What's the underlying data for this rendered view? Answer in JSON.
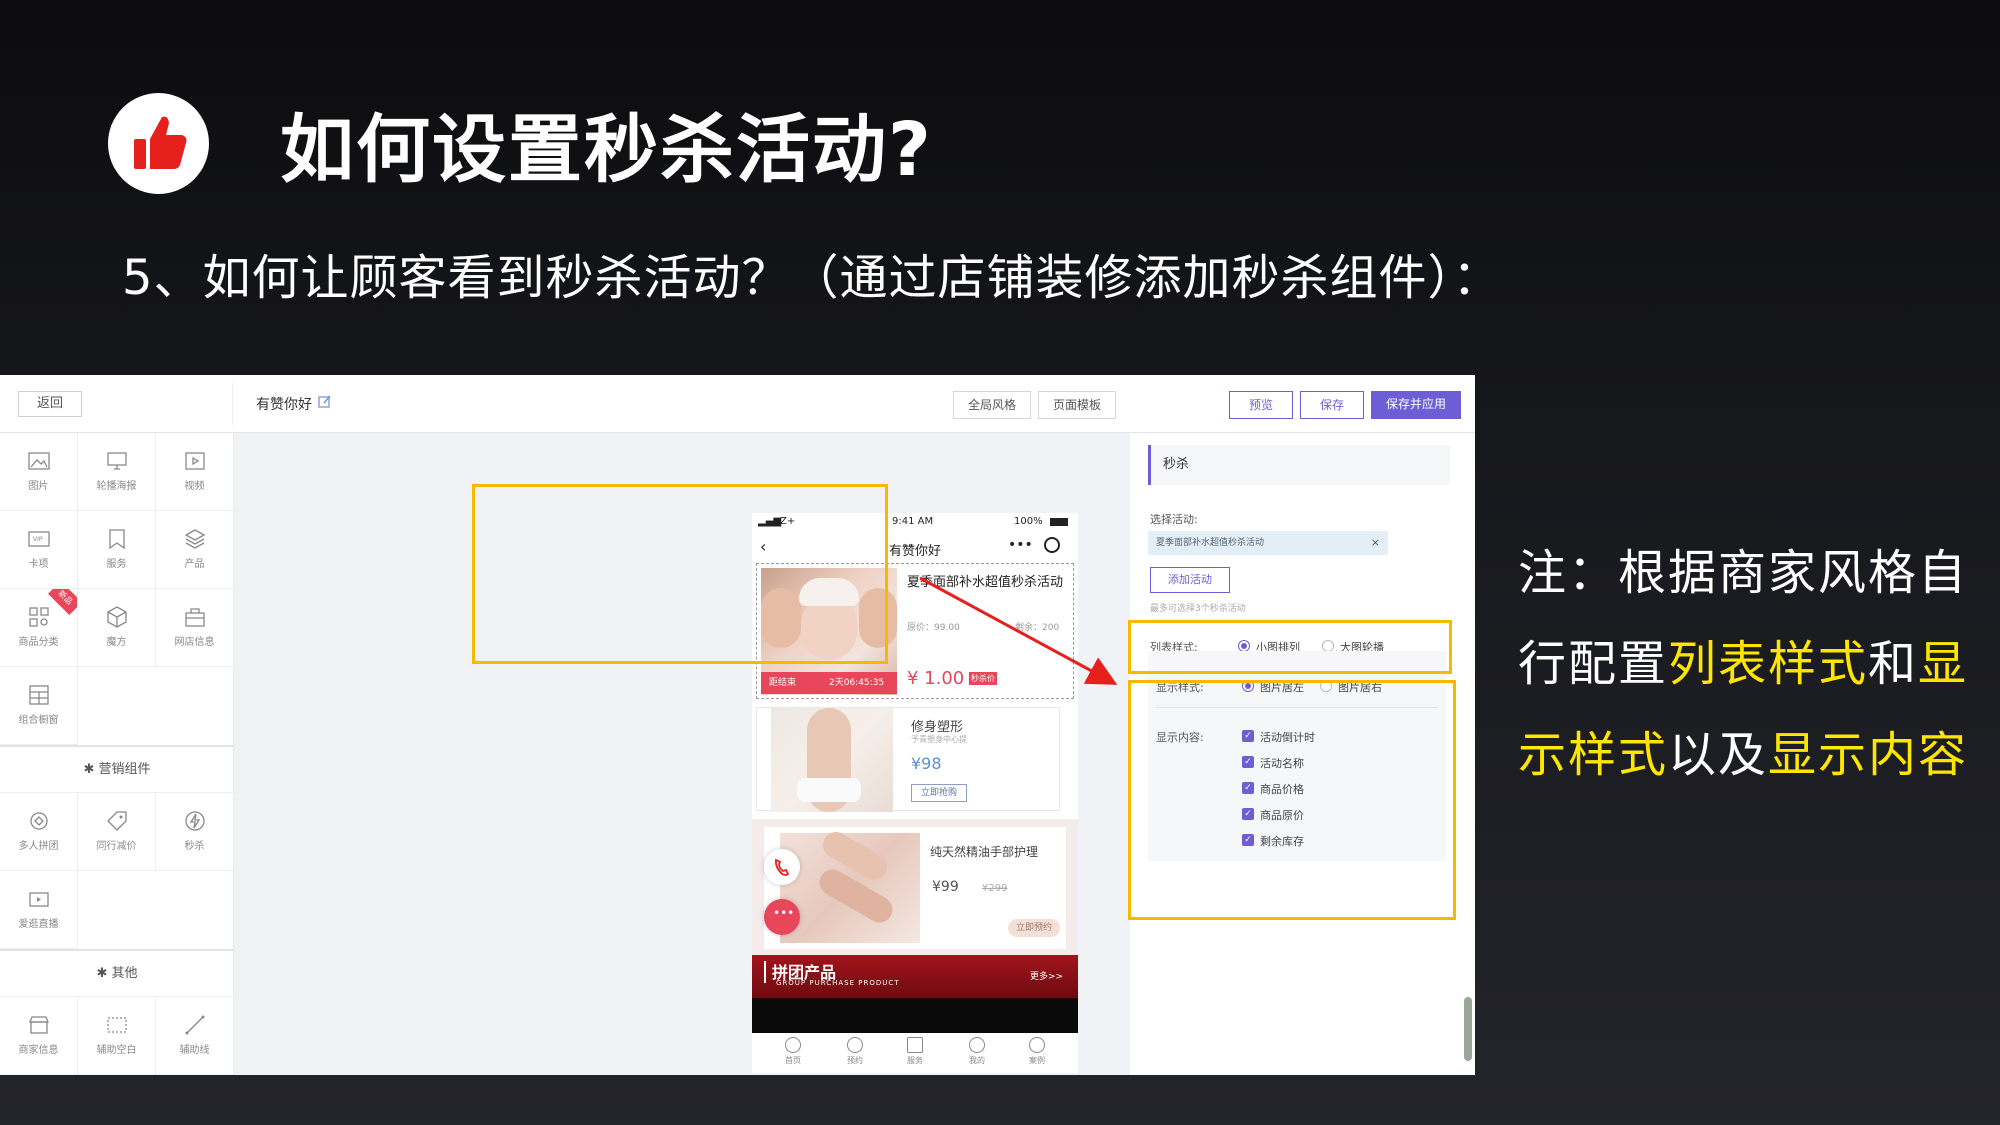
{
  "slide": {
    "title": "如何设置秒杀活动?",
    "subtitle": "5、如何让顾客看到秒杀活动？（通过店铺装修添加秒杀组件）：",
    "note": {
      "p1": "注：根据商家风格自行配置",
      "hl1": "列表样式",
      "p2": "和",
      "hl2": "显示样式",
      "p3": "以及",
      "hl3": "显示内容"
    },
    "highlight_color": "#ffe600",
    "box_color": "#f5b900",
    "arrow_color": "#e5201d"
  },
  "editor": {
    "back_label": "返回",
    "store_name": "有赞你好",
    "global_style": "全局风格",
    "page_template": "页面模板",
    "preview": "预览",
    "save": "保存",
    "save_apply": "保存并应用",
    "accent": "#6e5ed6"
  },
  "left_panel": {
    "basic": [
      "图片",
      "轮播海报",
      "视频",
      "卡项",
      "服务",
      "产品",
      "商品分类",
      "魔方",
      "网店信息",
      "组合橱窗"
    ],
    "ribbon": "新品",
    "marketing_title": "营销组件",
    "marketing": [
      "多人拼团",
      "同行减价",
      "秒杀",
      "爱逛直播"
    ],
    "other_title": "其他",
    "other": [
      "商家信息",
      "辅助空白",
      "辅助线"
    ]
  },
  "phone": {
    "carrier": "Z+",
    "time": "9:41 AM",
    "battery": "100%",
    "nav_title": "有赞你好",
    "item1": {
      "title": "夏季面部补水超值秒杀活动",
      "orig_price": "原价：99.00",
      "remaining": "剩余：200",
      "countdown_label": "距结束",
      "countdown": "2天06:45:35",
      "price": "¥ 1.00",
      "tag": "秒杀价"
    },
    "item2": {
      "title": "修身塑形",
      "sub": "予青塑身中心提",
      "price": "¥98",
      "button": "立即抢购"
    },
    "item3": {
      "title": "纯天然精油手部护理",
      "price": "¥99",
      "old_price": "¥299",
      "button": "立即预约"
    },
    "banner": {
      "title": "拼团产品",
      "en": "GROUP PURCHASE PRODUCT",
      "more": "更多>>"
    },
    "tabs": [
      "首页",
      "预约",
      "服务",
      "我的",
      "案例"
    ]
  },
  "right_panel": {
    "header": "秒杀",
    "select_label": "选择活动:",
    "selected_activity": "夏季面部补水超值秒杀活动",
    "add_button": "添加活动",
    "hint": "最多可选择3个秒杀活动",
    "list_style_label": "列表样式:",
    "list_opt1": "小图排列",
    "list_opt2": "大图轮播",
    "display_style_label": "显示样式:",
    "display_opt1": "图片居左",
    "display_opt2": "图片居右",
    "display_content_label": "显示内容:",
    "contents": [
      "活动倒计时",
      "活动名称",
      "商品价格",
      "商品原价",
      "剩余库存"
    ]
  }
}
